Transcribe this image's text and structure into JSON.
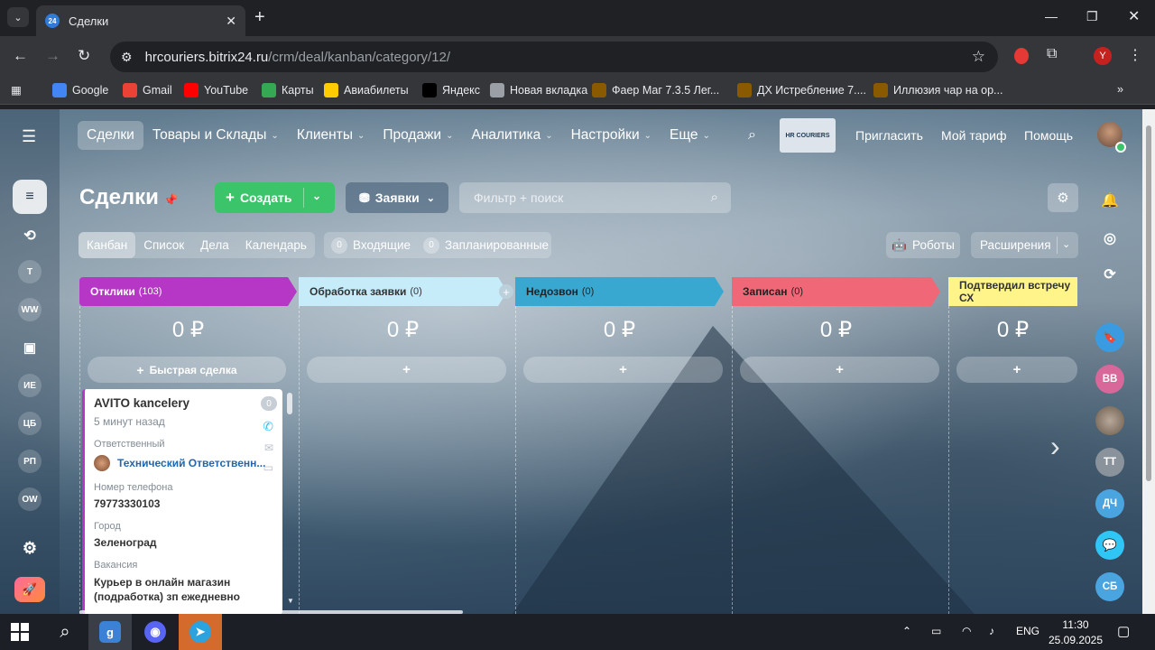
{
  "browser": {
    "tab_title": "Сделки",
    "tab_favicon": "24",
    "url_host": "hrcouriers.bitrix24.ru",
    "url_path": "/crm/deal/kanban/category/12/",
    "profile_letter": "Y",
    "bookmarks": [
      {
        "label": "Google",
        "icon": "google-icon",
        "color": "#4285f4"
      },
      {
        "label": "Gmail",
        "icon": "gmail-icon",
        "color": "#ea4335"
      },
      {
        "label": "YouTube",
        "icon": "youtube-icon",
        "color": "#ff0000"
      },
      {
        "label": "Карты",
        "icon": "maps-icon",
        "color": "#34a853"
      },
      {
        "label": "Авиабилеты",
        "icon": "plane-icon",
        "color": "#ffcc00"
      },
      {
        "label": "Яндекс",
        "icon": "yandex-icon",
        "color": "#000000"
      },
      {
        "label": "Новая вкладка",
        "icon": "globe-icon",
        "color": "#9aa0a6"
      },
      {
        "label": "Фаер Маг 7.3.5 Лег...",
        "icon": "wow-icon",
        "color": "#8a5a00"
      },
      {
        "label": "ДХ Истребление 7....",
        "icon": "wow-icon",
        "color": "#8a5a00"
      },
      {
        "label": "Иллюзия чар на ор...",
        "icon": "wow-icon",
        "color": "#8a5a00"
      }
    ]
  },
  "topnav": {
    "items": [
      {
        "label": "Сделки",
        "active": true,
        "caret": false
      },
      {
        "label": "Товары и Склады",
        "caret": true
      },
      {
        "label": "Клиенты",
        "caret": true
      },
      {
        "label": "Продажи",
        "caret": true
      },
      {
        "label": "Аналитика",
        "caret": true
      },
      {
        "label": "Настройки",
        "caret": true
      },
      {
        "label": "Еще",
        "caret": true
      }
    ],
    "logo_text": "HR COURIERS",
    "invite": "Пригласить",
    "tariff": "Мой тариф",
    "help": "Помощь"
  },
  "leftbar": {
    "items": [
      "Т",
      "WW",
      "ИЕ",
      "ЦБ",
      "РП",
      "OW"
    ]
  },
  "toolbar": {
    "title": "Сделки",
    "create_label": "Создать",
    "requests_label": "Заявки",
    "filter_placeholder": "Фильтр + поиск"
  },
  "views": {
    "tabs": [
      "Канбан",
      "Список",
      "Дела",
      "Календарь"
    ],
    "incoming_count": "0",
    "incoming_label": "Входящие",
    "planned_count": "0",
    "planned_label": "Запланированные",
    "robots_label": "Роботы",
    "extensions_label": "Расширения"
  },
  "kanban": {
    "columns": [
      {
        "title": "Отклики",
        "count": "(103)",
        "sum": "0 ₽",
        "quick": "Быстрая сделка",
        "color": "#b636c6",
        "text_color": "#ffffff"
      },
      {
        "title": "Обработка заявки",
        "count": "(0)",
        "sum": "0 ₽",
        "quick": "+",
        "color": "#c6ecfa",
        "text_color": "#333333"
      },
      {
        "title": "Недозвон",
        "count": "(0)",
        "sum": "0 ₽",
        "quick": "+",
        "color": "#39a8d1",
        "text_color": "#222222"
      },
      {
        "title": "Записан",
        "count": "(0)",
        "sum": "0 ₽",
        "quick": "+",
        "color": "#f06877",
        "text_color": "#222222"
      },
      {
        "title": "Подтвердил встречу СХ",
        "count": "",
        "sum": "0 ₽",
        "quick": "+",
        "color": "#fef48a",
        "text_color": "#333333"
      }
    ],
    "card": {
      "title": "AVITO kancelery",
      "badge": "0",
      "time": "5 минут назад",
      "responsible_label": "Ответственный",
      "responsible_name": "Технический Ответственн...",
      "phone_label": "Номер телефона",
      "phone": "79773330103",
      "city_label": "Город",
      "city": "Зеленоград",
      "vacancy_label": "Вакансия",
      "vacancy": "Курьер в онлайн магазин (подработка) зп ежедневно"
    }
  },
  "rightbar": {
    "items": [
      "ВВ",
      "ТТ",
      "ДЧ",
      "СБ"
    ]
  },
  "taskbar": {
    "lang": "ENG",
    "time": "11:30",
    "date": "25.09.2025"
  }
}
